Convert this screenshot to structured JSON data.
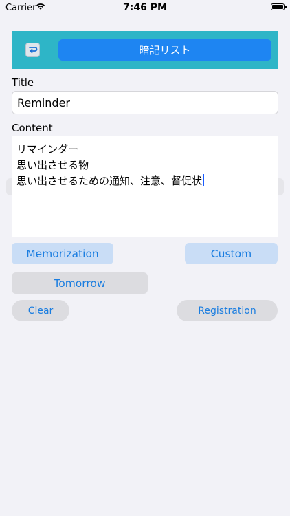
{
  "status_bar": {
    "carrier": "Carrier",
    "time": "7:46 PM",
    "battery_level": 1.0
  },
  "header": {
    "back_icon": "return-arrow-icon",
    "list_button_label": "暗記リスト",
    "background_color": "#2eb5c7",
    "button_color": "#1e85f2"
  },
  "form": {
    "title_label": "Title",
    "title_value": "Reminder",
    "content_label": "Content",
    "content_lines": [
      "リマインダー",
      "思い出させる物",
      "思い出させるための通知、注意、督促状"
    ]
  },
  "buttons": {
    "memorization": "Memorization",
    "custom": "Custom",
    "tomorrow": "Tomorrow",
    "clear": "Clear",
    "registration": "Registration"
  },
  "colors": {
    "background": "#f2f2f7",
    "accent_text": "#1a7de0",
    "selected_button": "#c9ddf6",
    "neutral_button": "#dcdce0"
  }
}
